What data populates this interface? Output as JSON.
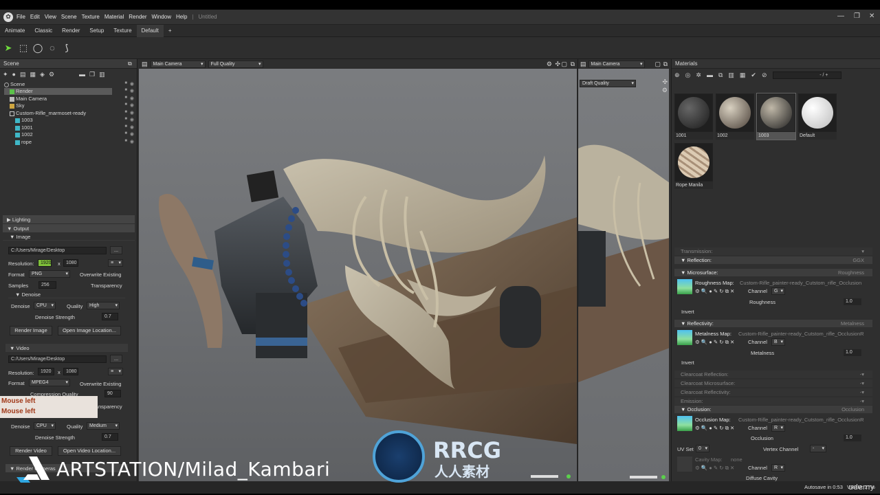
{
  "menu": {
    "items": [
      "File",
      "Edit",
      "View",
      "Scene",
      "Texture",
      "Material",
      "Render",
      "Window",
      "Help",
      "|",
      "Untitled"
    ],
    "window_controls": [
      "—",
      "❐",
      "✕"
    ]
  },
  "tabs": [
    "Animate",
    "Classic",
    "Render",
    "Setup",
    "Texture",
    "Default",
    "+"
  ],
  "active_tab": "Default",
  "scene": {
    "title": "Scene",
    "tree": [
      {
        "label": "Scene",
        "depth": 0
      },
      {
        "label": "Render",
        "depth": 1
      },
      {
        "label": "Main Camera",
        "depth": 1
      },
      {
        "label": "Sky",
        "depth": 1
      },
      {
        "label": "Custom-Rifle_marmoset-ready",
        "depth": 1
      },
      {
        "label": "1003",
        "depth": 2
      },
      {
        "label": "1001",
        "depth": 2
      },
      {
        "label": "1002",
        "depth": 2
      },
      {
        "label": "rope",
        "depth": 2
      }
    ]
  },
  "render": {
    "lighting": "Lighting",
    "output": "Output",
    "image": "Image",
    "image_path": "C:/Users/Mirage/Desktop",
    "browse": "...",
    "resolution_label": "Resolution:",
    "res_w": "1920",
    "x": "x",
    "res_h": "1080",
    "format_label": "Format",
    "format_image": "PNG",
    "overwrite": "Overwrite Existing",
    "samples_label": "Samples",
    "samples": "256",
    "transparency": "Transparency",
    "denoise": "Denoise",
    "denoise_label": "Denoise",
    "denoise_cpu": "CPU",
    "quality_label": "Quality",
    "quality_image": "High",
    "denoise_strength": "Denoise Strength",
    "strength_val": "0.7",
    "render_image": "Render Image",
    "open_image_loc": "Open Image Location...",
    "video": "Video",
    "video_path": "C:/Users/Mirage/Desktop",
    "format_video": "MPEG4",
    "compression": "Compression Quality",
    "compression_val": "90",
    "quality_video": "Medium",
    "render_video": "Render Video",
    "open_video_loc": "Open Video Location...",
    "render_cameras": "Render Cameras",
    "mouse_left_1": "Mouse left",
    "mouse_left_2": "Mouse left"
  },
  "viewport_main": {
    "camera": "Main Camera",
    "quality": "Full Quality"
  },
  "viewport_side": {
    "camera": "Main Camera",
    "quality": "Draft Quality"
  },
  "materials": {
    "title": "Materials",
    "counter": "- / +",
    "items": [
      {
        "name": "1001",
        "color": "#2a2a2a"
      },
      {
        "name": "1002",
        "color": "#b8b0a0"
      },
      {
        "name": "1003",
        "color": "#4a4a4a"
      },
      {
        "name": "Default",
        "color": "#f2f2f2"
      },
      {
        "name": "Rope Manila",
        "color": "#c9b9a3"
      }
    ],
    "transmission": "Transmission:",
    "reflection": "Reflection:",
    "reflection_val": "GGX",
    "microsurface": "Microsurface:",
    "microsurface_val": "Roughness",
    "roughness_map": "Roughness Map:",
    "roughness_file": "Custom-Rifle_painter-ready_Cutstom_rifle_Occlusion",
    "channel": "Channel",
    "channel_g": "G",
    "roughness": "Roughness",
    "one": "1.0",
    "invert": "Invert",
    "reflectivity": "Reflectivity:",
    "reflectivity_val": "Metalness",
    "metalness_map": "Metalness Map:",
    "metalness_file": "Custom-Rifle_painter-ready_Cutstom_rifle_OcclusionR",
    "channel_b": "B",
    "metalness": "Metalness",
    "clearcoat_reflection": "Clearcoat Reflection:",
    "clearcoat_micro": "Clearcoat Microsurface:",
    "clearcoat_reflectivity": "Clearcoat Reflectivity:",
    "emission": "Emission:",
    "occlusion": "Occlusion:",
    "occlusion_val": "Occlusion",
    "occlusion_map": "Occlusion Map:",
    "occlusion_file": "Custom-Rifle_painter-ready_Cutstom_rifle_OcclusionR",
    "channel_r": "R",
    "occlusion_label": "Occlusion",
    "uv_set": "UV Set",
    "uv_val": "0",
    "vertex_channel": "Vertex Channel",
    "vertex_val": "-",
    "cavity_map": "Cavity Map:",
    "cavity_val": "none",
    "diffuse_cavity": "Diffuse Cavity"
  },
  "status": {
    "autosave": "Autosave in 0:53",
    "vram": "VRAM: 27%"
  },
  "overlays": {
    "artstation": "ARTSTATION/Milad_Kambari",
    "rrcg": "RRCG",
    "rrcg_sub": "人人素材",
    "udemy": "udemy"
  }
}
